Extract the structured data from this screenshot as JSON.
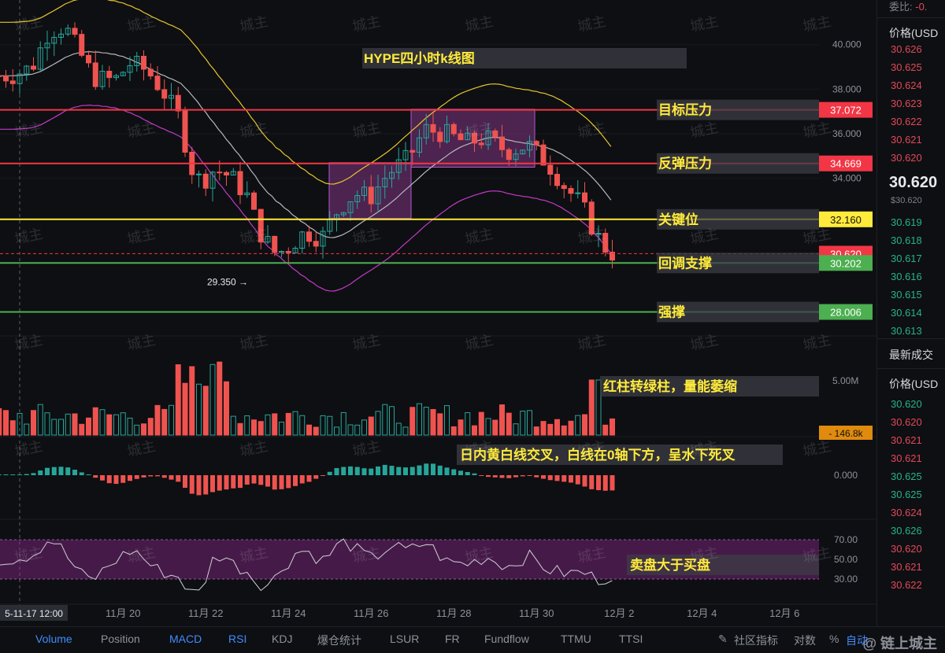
{
  "title": "HYPE四小时k线图",
  "chart_data": {
    "type": "candlestick",
    "symbol": "HYPE",
    "interval": "4h",
    "y_range": [
      27.0,
      42.0
    ],
    "price_ticks": [
      "40.000",
      "38.000",
      "36.000",
      "34.000"
    ],
    "date_ticks": [
      "11月 20",
      "11月 22",
      "11月 24",
      "11月 26",
      "11月 28",
      "11月 30",
      "12月 2",
      "12月 4",
      "12月 6"
    ],
    "cursor_date": "5-11-17 12:00",
    "current_price": 30.62,
    "low_marker": "29.350",
    "levels": [
      {
        "value": 37.072,
        "label": "目标压力",
        "tag": "37.072",
        "color": "#f23645"
      },
      {
        "value": 34.669,
        "label": "反弹压力",
        "tag": "34.669",
        "color": "#f23645"
      },
      {
        "value": 32.16,
        "label": "关键位",
        "tag": "32.160",
        "color": "#ffeb3b"
      },
      {
        "value": 30.62,
        "label": "",
        "tag": "30.620",
        "color": "#f23645"
      },
      {
        "value": 30.202,
        "label": "回调支撑",
        "tag": "30.202",
        "color": "#4caf50"
      },
      {
        "value": 28.006,
        "label": "强撑",
        "tag": "28.006",
        "color": "#4caf50"
      }
    ],
    "zones": [
      {
        "from_date": "11月 25",
        "to_date": "11月 26",
        "low": 32.2,
        "high": 34.7
      },
      {
        "from_date": "11月 27",
        "to_date": "11月 29",
        "low": 34.5,
        "high": 37.1
      }
    ],
    "volume": {
      "tick": "5.00M",
      "current": "146.8k",
      "note": "红柱转绿柱，量能萎缩"
    },
    "macd": {
      "tick": "0.000",
      "note": "日内黄白线交叉，白线在0轴下方，呈水下死叉"
    },
    "rsi": {
      "ticks": [
        "70.00",
        "50.00",
        "30.00"
      ],
      "note": "卖盘大于买盘"
    }
  },
  "watermark": "城主",
  "orderbook": {
    "top_label": "委比:",
    "top_value": "-0.",
    "price_header": "价格(USD",
    "asks": [
      "30.626",
      "30.625",
      "30.624",
      "30.623",
      "30.622",
      "30.621",
      "30.620"
    ],
    "last_price": "30.620",
    "last_sub": "$30.620",
    "bids": [
      "30.619",
      "30.618",
      "30.617",
      "30.616",
      "30.615",
      "30.614",
      "30.613"
    ],
    "trades_title": "最新成交",
    "trades_header": "价格(USD",
    "trades": [
      {
        "p": "30.620",
        "c": "green"
      },
      {
        "p": "30.620",
        "c": "red"
      },
      {
        "p": "30.621",
        "c": "red"
      },
      {
        "p": "30.621",
        "c": "red"
      },
      {
        "p": "30.625",
        "c": "green"
      },
      {
        "p": "30.625",
        "c": "green"
      },
      {
        "p": "30.624",
        "c": "red"
      },
      {
        "p": "30.626",
        "c": "green"
      },
      {
        "p": "30.620",
        "c": "red"
      },
      {
        "p": "30.621",
        "c": "red"
      },
      {
        "p": "30.622",
        "c": "red"
      }
    ]
  },
  "toolbar": {
    "tabs": [
      "Volume",
      "Position",
      "MACD",
      "RSI",
      "KDJ",
      "爆仓统计",
      "LSUR",
      "FR",
      "Fundflow",
      "TTMU",
      "TTSI"
    ],
    "right_items": [
      "社区指标",
      "对数",
      "%",
      "自动"
    ],
    "brand": "@ 链上城主"
  }
}
